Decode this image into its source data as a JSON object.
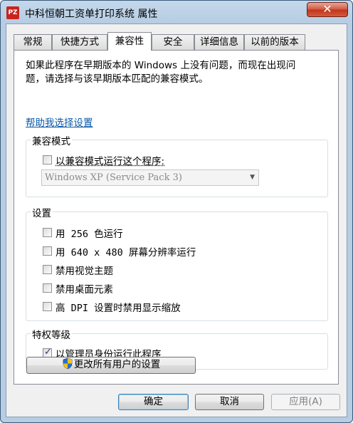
{
  "window": {
    "title": "中科恒朝工资单打印系统 属性",
    "app_icon_text": "PZ",
    "close_glyph": "✕"
  },
  "tabs": [
    {
      "label": "常规",
      "active": false
    },
    {
      "label": "快捷方式",
      "active": false
    },
    {
      "label": "兼容性",
      "active": true
    },
    {
      "label": "安全",
      "active": false
    },
    {
      "label": "详细信息",
      "active": false
    },
    {
      "label": "以前的版本",
      "active": false
    }
  ],
  "compat": {
    "intro_line1": "如果此程序在早期版本的 Windows 上没有问题，而现在出现问",
    "intro_line2": "题，请选择与该早期版本匹配的兼容模式。",
    "help_link": "帮助我选择设置",
    "mode_group": {
      "title": "兼容模式",
      "checkbox_label": "以兼容模式运行这个程序:",
      "checked": false,
      "select_value": "Windows XP (Service Pack 3)"
    },
    "settings_group": {
      "title": "设置",
      "options": [
        {
          "label": "用 256 色运行",
          "checked": false
        },
        {
          "label": "用 640 x 480 屏幕分辨率运行",
          "checked": false
        },
        {
          "label": "禁用视觉主题",
          "checked": false
        },
        {
          "label": "禁用桌面元素",
          "checked": false
        },
        {
          "label": "高 DPI 设置时禁用显示缩放",
          "checked": false
        }
      ]
    },
    "privilege_group": {
      "title": "特权等级",
      "checkbox_label": "以管理员身份运行此程序",
      "checked": true
    },
    "all_users_button": "更改所有用户的设置"
  },
  "buttons": {
    "ok": "确定",
    "cancel": "取消",
    "apply": "应用(A)"
  }
}
